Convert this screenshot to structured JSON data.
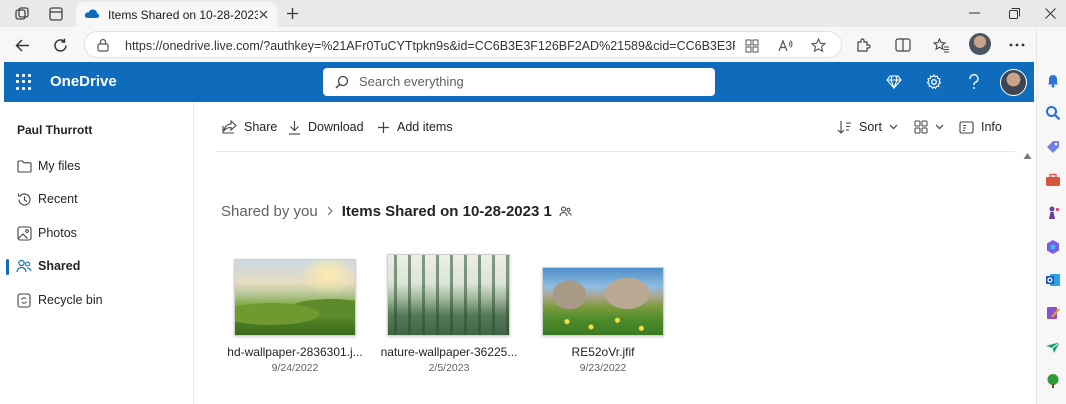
{
  "browser": {
    "tab_title": "Items Shared on 10-28-2023 1 -",
    "url": "https://onedrive.live.com/?authkey=%21AFr0TuCYTtpkn9s&id=CC6B3E3F126BF2AD%21589&cid=CC6B3E3F126BF2AD"
  },
  "app": {
    "brand": "OneDrive",
    "search_placeholder": "Search everything"
  },
  "nav": {
    "user_name": "Paul Thurrott",
    "items": [
      {
        "label": "My files",
        "icon": "folder-icon"
      },
      {
        "label": "Recent",
        "icon": "history-icon"
      },
      {
        "label": "Photos",
        "icon": "image-icon"
      },
      {
        "label": "Shared",
        "icon": "people-icon",
        "selected": true
      },
      {
        "label": "Recycle bin",
        "icon": "recycle-bin-icon"
      }
    ]
  },
  "commands": {
    "share": "Share",
    "download": "Download",
    "add_items": "Add items",
    "sort": "Sort",
    "info": "Info"
  },
  "breadcrumb": {
    "parent": "Shared by you",
    "current": "Items Shared on 10-28-2023 1"
  },
  "files": [
    {
      "name": "hd-wallpaper-2836301.j...",
      "date": "9/24/2022"
    },
    {
      "name": "nature-wallpaper-36225...",
      "date": "2/5/2023"
    },
    {
      "name": "RE52oVr.jfif",
      "date": "9/23/2022"
    }
  ],
  "colors": {
    "brand_blue": "#0f6cbd"
  }
}
